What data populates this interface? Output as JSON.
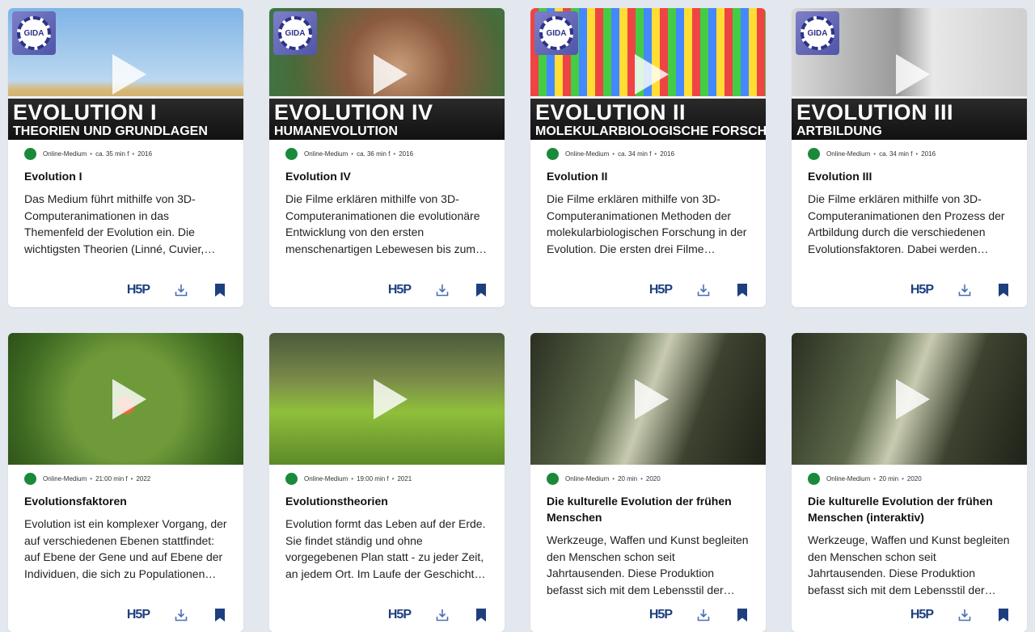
{
  "cards": [
    {
      "banner_title": "EVOLUTION  I",
      "banner_sub": "THEORIEN UND GRUNDLAGEN",
      "logo_text": "GIDA",
      "medium": "Online-Medium",
      "duration": "ca. 35 min f",
      "year": "2016",
      "title": "Evolution I",
      "description": "Das Medium führt mithilfe von 3D-Computeranimationen in das Themenfeld der Evolution ein. Die wichtigsten Theorien (Linné, Cuvier, Lamarck, Darwin) werden erklärt.",
      "h5p": "H5P"
    },
    {
      "banner_title": "EVOLUTION  IV",
      "banner_sub": "HUMANEVOLUTION",
      "logo_text": "GIDA",
      "medium": "Online-Medium",
      "duration": "ca. 36 min f",
      "year": "2016",
      "title": "Evolution IV",
      "description": "Die Filme erklären mithilfe von 3D-Computeranimationen die evolutionäre Entwicklung von den ersten menschenartigen Lebewesen bis zum modernen Menschen.",
      "h5p": "H5P"
    },
    {
      "banner_title": "EVOLUTION  II",
      "banner_sub": "MOLEKULARBIOLOGISCHE FORSCHUNG",
      "logo_text": "GIDA",
      "medium": "Online-Medium",
      "duration": "ca. 34 min f",
      "year": "2016",
      "title": "Evolution II",
      "description": "Die Filme erklären mithilfe von 3D-Computeranimationen Methoden der molekularbiologischen Forschung in der Evolution. Die ersten drei Filme behandeln die Grundlagen.",
      "h5p": "H5P"
    },
    {
      "banner_title": "EVOLUTION  III",
      "banner_sub": "ARTBILDUNG",
      "logo_text": "GIDA",
      "medium": "Online-Medium",
      "duration": "ca. 34 min f",
      "year": "2016",
      "title": "Evolution III",
      "description": "Die Filme erklären mithilfe von 3D-Computeranimationen den Prozess der Artbildung durch die verschiedenen Evolutionsfaktoren. Dabei werden Beispiele gezeigt.",
      "h5p": "H5P"
    },
    {
      "medium": "Online-Medium",
      "duration": "21:00 min f",
      "year": "2022",
      "title": "Evolutionsfaktoren",
      "description": "Evolution ist ein komplexer Vorgang, der auf verschiedenen Ebenen stattfindet: auf Ebene der Gene und auf Ebene der Individuen, die sich zu Populationen zusammenfinden.",
      "h5p": "H5P"
    },
    {
      "medium": "Online-Medium",
      "duration": "19:00 min f",
      "year": "2021",
      "title": "Evolutionstheorien",
      "description": "Evolution formt das Leben auf der Erde. Sie findet ständig und ohne vorgegebenen Plan statt - zu jeder Zeit, an jedem Ort. Im Laufe der Geschichte entstanden Theorien.",
      "h5p": "H5P"
    },
    {
      "medium": "Online-Medium",
      "duration": "20 min",
      "year": "2020",
      "title": "Die kulturelle Evolution der frühen Menschen",
      "description": "Werkzeuge, Waffen und Kunst begleiten den Menschen schon seit Jahrtausenden. Diese Produktion befasst sich mit dem Lebensstil der frühen Menschen.",
      "h5p": "H5P"
    },
    {
      "medium": "Online-Medium",
      "duration": "20 min",
      "year": "2020",
      "title": "Die kulturelle Evolution der frühen Menschen (interaktiv)",
      "description": "Werkzeuge, Waffen und Kunst begleiten den Menschen schon seit Jahrtausenden. Diese Produktion befasst sich mit dem Lebensstil der frühen Menschen.",
      "h5p": "H5P"
    }
  ],
  "colors": {
    "page_bg": "#e3e7ee",
    "status_dot": "#1a8a3a",
    "action_blue": "#1e3f7e",
    "download_icon": "#4a6fb5"
  },
  "icons": [
    "play-icon",
    "download-icon",
    "bookmark-icon",
    "gida-logo"
  ]
}
